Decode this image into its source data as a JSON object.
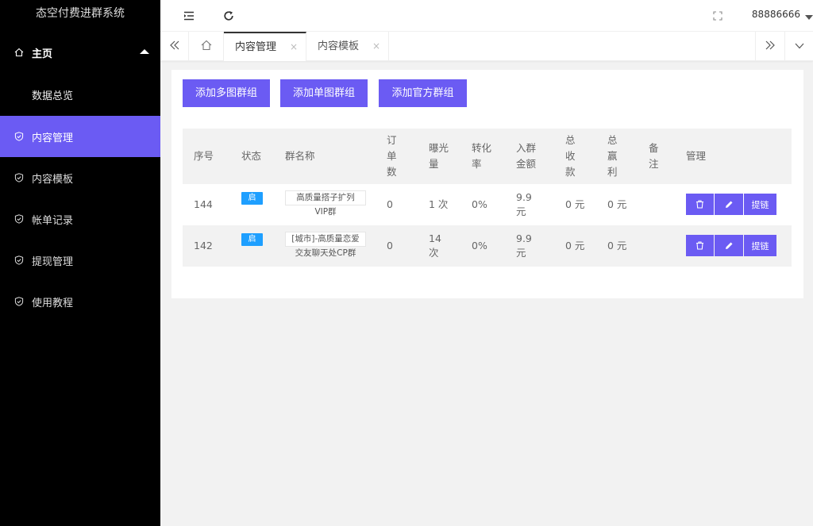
{
  "app": {
    "title": "态空付费进群系统"
  },
  "sidebar": {
    "group": {
      "label": "主页"
    },
    "sub_items": [
      {
        "label": "数据总览"
      }
    ],
    "items": [
      {
        "label": "内容管理",
        "active": true
      },
      {
        "label": "内容模板"
      },
      {
        "label": "帐单记录"
      },
      {
        "label": "提现管理"
      },
      {
        "label": "使用教程"
      }
    ]
  },
  "header": {
    "user": "88886666"
  },
  "tabs": [
    {
      "label": "内容管理",
      "close": "×",
      "active": true
    },
    {
      "label": "内容模板",
      "close": "×"
    }
  ],
  "toolbar": {
    "add_multi": "添加多图群组",
    "add_single": "添加单图群组",
    "add_official": "添加官方群组"
  },
  "table": {
    "headers": {
      "seq": "序号",
      "status": "状态",
      "name": "群名称",
      "orders_1": "订",
      "orders_2": "单",
      "orders_3": "数",
      "views_1": "曝光",
      "views_2": "量",
      "conv_1": "转化",
      "conv_2": "率",
      "fee_1": "入群",
      "fee_2": "金额",
      "income_1": "总",
      "income_2": "收",
      "income_3": "款",
      "profit_1": "总",
      "profit_2": "赢",
      "profit_3": "利",
      "remark_1": "备",
      "remark_2": "注",
      "manage": "管理"
    },
    "rows": [
      {
        "seq": "144",
        "status": "启",
        "name_1": "高质量搭子扩列",
        "name_2": "VIP群",
        "orders": "0",
        "views_1": "1 次",
        "views_2": "",
        "conv": "0%",
        "fee_1": "9.9",
        "fee_2": "元",
        "income": "0 元",
        "profit": "0 元",
        "remark": "",
        "link": "提链"
      },
      {
        "seq": "142",
        "status": "启",
        "name_1": "[城市]-高质量恋爱",
        "name_2": "交友聊天处CP群",
        "orders": "0",
        "views_1": "14",
        "views_2": "次",
        "conv": "0%",
        "fee_1": "9.9",
        "fee_2": "元",
        "income": "0 元",
        "profit": "0 元",
        "remark": "",
        "link": "提链"
      }
    ]
  },
  "colors": {
    "accent": "#6b5bf3",
    "badge": "#1e9fff",
    "sidebar": "#000000"
  },
  "icons": {
    "menu": "menu-fold-icon",
    "refresh": "refresh-icon",
    "fullscreen": "fullscreen-icon",
    "home": "home-icon",
    "shield": "shield-check-icon",
    "delete": "trash-icon",
    "edit": "pencil-icon"
  }
}
